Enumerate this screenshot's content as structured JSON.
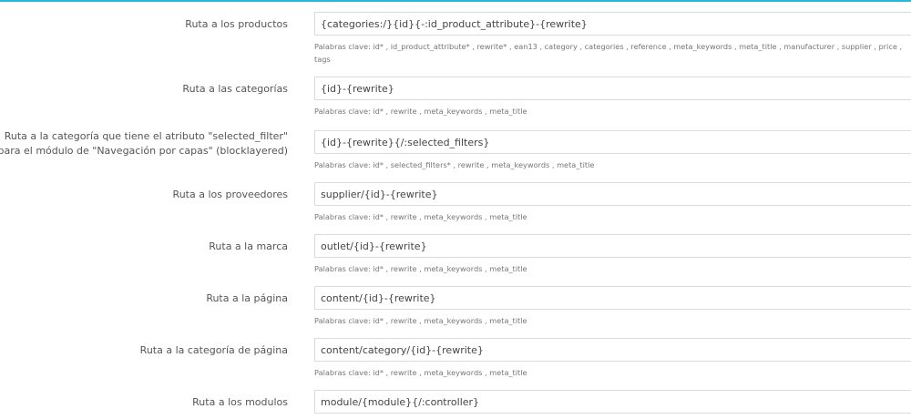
{
  "accent_color": "#25b9d7",
  "routes": [
    {
      "label": "Ruta a los productos",
      "value": "{categories:/}{id}{-:id_product_attribute}-{rewrite}",
      "help": "Palabras clave: id* , id_product_attribute* , rewrite* , ean13 , category , categories , reference , meta_keywords , meta_title , manufacturer , supplier , price , tags"
    },
    {
      "label": "Ruta a las categorías",
      "value": "{id}-{rewrite}",
      "help": "Palabras clave: id* , rewrite , meta_keywords , meta_title"
    },
    {
      "label": "Ruta a la categoría que tiene el atributo \"selected_filter\" para el módulo de \"Navegación por capas\" (blocklayered)",
      "value": "{id}-{rewrite}{/:selected_filters}",
      "help": "Palabras clave: id* , selected_filters* , rewrite , meta_keywords , meta_title"
    },
    {
      "label": "Ruta a los proveedores",
      "value": "supplier/{id}-{rewrite}",
      "help": "Palabras clave: id* , rewrite , meta_keywords , meta_title"
    },
    {
      "label": "Ruta a la marca",
      "value": "outlet/{id}-{rewrite}",
      "help": "Palabras clave: id* , rewrite , meta_keywords , meta_title"
    },
    {
      "label": "Ruta a la página",
      "value": "content/{id}-{rewrite}",
      "help": "Palabras clave: id* , rewrite , meta_keywords , meta_title"
    },
    {
      "label": "Ruta a la categoría de página",
      "value": "content/category/{id}-{rewrite}",
      "help": "Palabras clave: id* , rewrite , meta_keywords , meta_title"
    },
    {
      "label": "Ruta a los modulos",
      "value": "module/{module}{/:controller}",
      "help": null
    }
  ]
}
